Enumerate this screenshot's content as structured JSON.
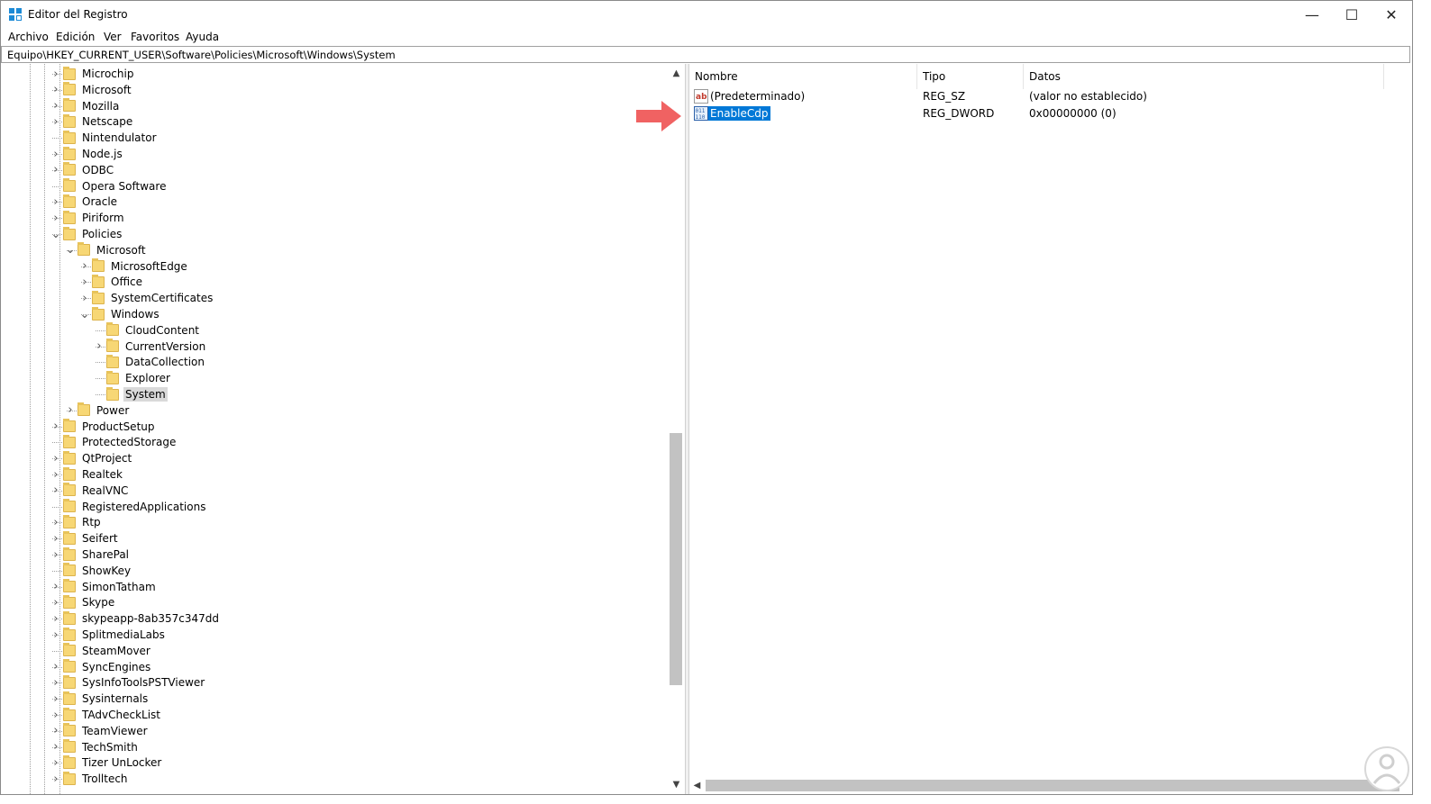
{
  "window": {
    "title": "Editor del Registro",
    "controls": {
      "minimize": "—",
      "maximize": "☐",
      "close": "✕"
    }
  },
  "menu": [
    "Archivo",
    "Edición",
    "Ver",
    "Favoritos",
    "Ayuda"
  ],
  "address": "Equipo\\HKEY_CURRENT_USER\\Software\\Policies\\Microsoft\\Windows\\System",
  "tree": [
    {
      "label": "Microchip",
      "depth": 0,
      "exp": "closed"
    },
    {
      "label": "Microsoft",
      "depth": 0,
      "exp": "closed"
    },
    {
      "label": "Mozilla",
      "depth": 0,
      "exp": "closed"
    },
    {
      "label": "Netscape",
      "depth": 0,
      "exp": "closed"
    },
    {
      "label": "Nintendulator",
      "depth": 0,
      "exp": "none"
    },
    {
      "label": "Node.js",
      "depth": 0,
      "exp": "closed"
    },
    {
      "label": "ODBC",
      "depth": 0,
      "exp": "closed"
    },
    {
      "label": "Opera Software",
      "depth": 0,
      "exp": "none"
    },
    {
      "label": "Oracle",
      "depth": 0,
      "exp": "closed"
    },
    {
      "label": "Piriform",
      "depth": 0,
      "exp": "closed"
    },
    {
      "label": "Policies",
      "depth": 0,
      "exp": "open"
    },
    {
      "label": "Microsoft",
      "depth": 1,
      "exp": "open"
    },
    {
      "label": "MicrosoftEdge",
      "depth": 2,
      "exp": "closed"
    },
    {
      "label": "Office",
      "depth": 2,
      "exp": "closed"
    },
    {
      "label": "SystemCertificates",
      "depth": 2,
      "exp": "closed"
    },
    {
      "label": "Windows",
      "depth": 2,
      "exp": "open"
    },
    {
      "label": "CloudContent",
      "depth": 3,
      "exp": "none"
    },
    {
      "label": "CurrentVersion",
      "depth": 3,
      "exp": "closed"
    },
    {
      "label": "DataCollection",
      "depth": 3,
      "exp": "none"
    },
    {
      "label": "Explorer",
      "depth": 3,
      "exp": "none"
    },
    {
      "label": "System",
      "depth": 3,
      "exp": "none",
      "selected": true
    },
    {
      "label": "Power",
      "depth": 1,
      "exp": "closed"
    },
    {
      "label": "ProductSetup",
      "depth": 0,
      "exp": "closed"
    },
    {
      "label": "ProtectedStorage",
      "depth": 0,
      "exp": "none"
    },
    {
      "label": "QtProject",
      "depth": 0,
      "exp": "closed"
    },
    {
      "label": "Realtek",
      "depth": 0,
      "exp": "closed"
    },
    {
      "label": "RealVNC",
      "depth": 0,
      "exp": "closed"
    },
    {
      "label": "RegisteredApplications",
      "depth": 0,
      "exp": "none"
    },
    {
      "label": "Rtp",
      "depth": 0,
      "exp": "closed"
    },
    {
      "label": "Seifert",
      "depth": 0,
      "exp": "closed"
    },
    {
      "label": "SharePal",
      "depth": 0,
      "exp": "closed"
    },
    {
      "label": "ShowKey",
      "depth": 0,
      "exp": "none"
    },
    {
      "label": "SimonTatham",
      "depth": 0,
      "exp": "closed"
    },
    {
      "label": "Skype",
      "depth": 0,
      "exp": "closed"
    },
    {
      "label": "skypeapp-8ab357c347dd",
      "depth": 0,
      "exp": "closed"
    },
    {
      "label": "SplitmediaLabs",
      "depth": 0,
      "exp": "closed"
    },
    {
      "label": "SteamMover",
      "depth": 0,
      "exp": "none"
    },
    {
      "label": "SyncEngines",
      "depth": 0,
      "exp": "closed"
    },
    {
      "label": "SysInfoToolsPSTViewer",
      "depth": 0,
      "exp": "closed"
    },
    {
      "label": "Sysinternals",
      "depth": 0,
      "exp": "closed"
    },
    {
      "label": "TAdvCheckList",
      "depth": 0,
      "exp": "closed"
    },
    {
      "label": "TeamViewer",
      "depth": 0,
      "exp": "closed"
    },
    {
      "label": "TechSmith",
      "depth": 0,
      "exp": "closed"
    },
    {
      "label": "Tizer UnLocker",
      "depth": 0,
      "exp": "closed"
    },
    {
      "label": "Trolltech",
      "depth": 0,
      "exp": "closed"
    }
  ],
  "list": {
    "columns": [
      "Nombre",
      "Tipo",
      "Datos"
    ],
    "rows": [
      {
        "name": "(Predeterminado)",
        "type": "REG_SZ",
        "data": "(valor no establecido)",
        "icon": "string-value-icon",
        "selected": false
      },
      {
        "name": "EnableCdp",
        "type": "REG_DWORD",
        "data": "0x00000000 (0)",
        "icon": "dword-value-icon",
        "selected": true
      }
    ]
  },
  "colors": {
    "selection": "#0078d7",
    "folder": "#f7d775",
    "annotation_arrow": "#f06262"
  }
}
